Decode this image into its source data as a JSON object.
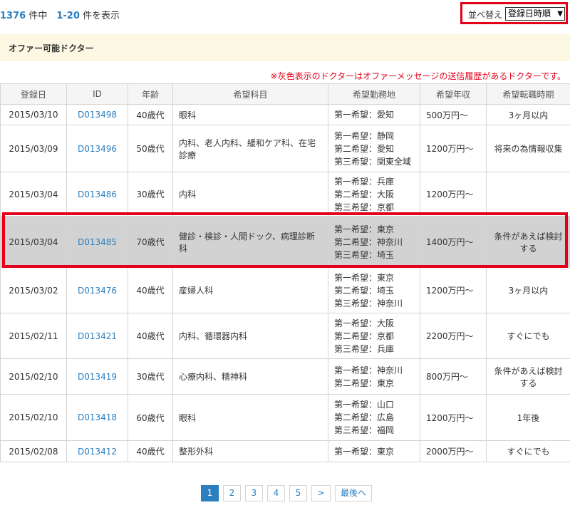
{
  "header": {
    "total": "1376",
    "total_suffix": " 件中",
    "range": "1-20",
    "range_suffix": " 件を表示",
    "sort_label": "並べ替え",
    "sort_value": "登録日時順"
  },
  "section_title": "オファー可能ドクター",
  "note": "※灰色表示のドクターはオファーメッセージの送信履歴があるドクターです。",
  "columns": [
    "登録日",
    "ID",
    "年齢",
    "希望科目",
    "希望勤務地",
    "希望年収",
    "希望転職時期"
  ],
  "rows": [
    {
      "date": "2015/03/10",
      "id": "D013498",
      "age": "40歳代",
      "dept": "眼科",
      "loc": [
        "第一希望：愛知"
      ],
      "salary": "500万円〜",
      "timing": "3ヶ月以内"
    },
    {
      "date": "2015/03/09",
      "id": "D013496",
      "age": "50歳代",
      "dept": "内科、老人内科、緩和ケア科、在宅診療",
      "loc": [
        "第一希望：静岡",
        "第二希望：愛知",
        "第三希望：関東全域"
      ],
      "salary": "1200万円〜",
      "timing": "将来の為情報収集"
    },
    {
      "date": "2015/03/04",
      "id": "D013486",
      "age": "30歳代",
      "dept": "内科",
      "loc": [
        "第一希望：兵庫",
        "第二希望：大阪",
        "第三希望：京都"
      ],
      "salary": "1200万円〜",
      "timing": ""
    },
    {
      "date": "2015/03/04",
      "id": "D013485",
      "age": "70歳代",
      "dept": "健診・検診・人間ドック、病理診断科",
      "loc": [
        "第一希望：東京",
        "第二希望：神奈川",
        "第三希望：埼玉"
      ],
      "salary": "1400万円〜",
      "timing": "条件があえば検討する"
    },
    {
      "date": "2015/03/02",
      "id": "D013476",
      "age": "40歳代",
      "dept": "産婦人科",
      "loc": [
        "第一希望：東京",
        "第二希望：埼玉",
        "第三希望：神奈川"
      ],
      "salary": "1200万円〜",
      "timing": "3ヶ月以内"
    },
    {
      "date": "2015/02/11",
      "id": "D013421",
      "age": "40歳代",
      "dept": "内科、循環器内科",
      "loc": [
        "第一希望：大阪",
        "第二希望：京都",
        "第三希望：兵庫"
      ],
      "salary": "2200万円〜",
      "timing": "すぐにでも"
    },
    {
      "date": "2015/02/10",
      "id": "D013419",
      "age": "30歳代",
      "dept": "心療内科、精神科",
      "loc": [
        "第一希望：神奈川",
        "第二希望：東京"
      ],
      "salary": "800万円〜",
      "timing": "条件があえば検討する"
    },
    {
      "date": "2015/02/10",
      "id": "D013418",
      "age": "60歳代",
      "dept": "眼科",
      "loc": [
        "第一希望：山口",
        "第二希望：広島",
        "第三希望：福岡"
      ],
      "salary": "1200万円〜",
      "timing": "1年後"
    },
    {
      "date": "2015/02/08",
      "id": "D013412",
      "age": "40歳代",
      "dept": "整形外科",
      "loc": [
        "第一希望：東京"
      ],
      "salary": "2000万円〜",
      "timing": "すぐにでも"
    }
  ],
  "pagination": {
    "pages": [
      "1",
      "2",
      "3",
      "4",
      "5"
    ],
    "current": "1",
    "next": ">",
    "last": "最後へ"
  }
}
